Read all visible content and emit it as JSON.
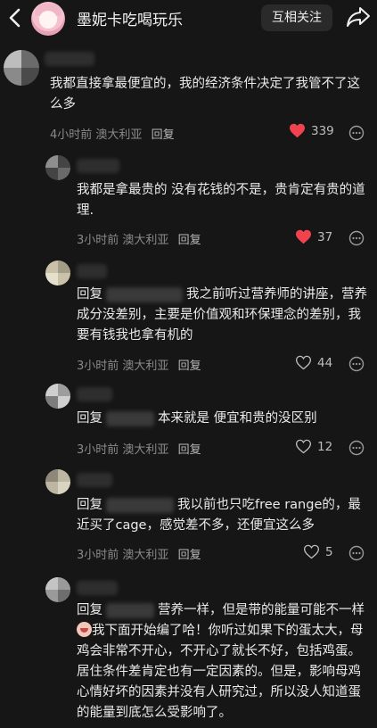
{
  "header": {
    "title": "墨妮卡吃喝玩乐",
    "follow_label": "互相关注"
  },
  "comments": [
    {
      "text": "我都直接拿最便宜的，我的经济条件决定了我管不了这么多",
      "time": "4小时前",
      "location": "澳大利亚",
      "reply_label": "回复",
      "likes": "339",
      "liked": true
    },
    {
      "text": "我都是拿最贵的 没有花钱的不是，贵肯定有贵的道理.",
      "time": "3小时前",
      "location": "澳大利亚",
      "reply_label": "回复",
      "likes": "37",
      "liked": true
    },
    {
      "reply_prefix": "回复",
      "text": "我之前听过营养师的讲座，营养成分没差别，主要是价值观和环保理念的差别，我要有钱我也拿有机的",
      "time": "3小时前",
      "location": "澳大利亚",
      "reply_label": "回复",
      "likes": "44",
      "liked": false
    },
    {
      "reply_prefix": "回复",
      "text": "本来就是 便宜和贵的没区别",
      "time": "3小时前",
      "location": "澳大利亚",
      "reply_label": "回复",
      "likes": "12",
      "liked": false
    },
    {
      "reply_prefix": "回复",
      "text": "我以前也只吃free range的，最近买了cage，感觉差不多，还便宜这么多",
      "time": "3小时前",
      "location": "澳大利亚",
      "reply_label": "回复",
      "likes": "5",
      "liked": false
    },
    {
      "reply_prefix": "回复",
      "text_a": "营养一样，但是带的能量可能不一样",
      "text_b": "我下面开始编了哈！你听过如果下的蛋太大，母鸡会非常不开心，不开心了就长不好，包括鸡蛋。居住条件差肯定也有一定因素的。但是，影响母鸡心情好坏的因素并没有人研究过，所以没人知道蛋的能量到底怎么受影响了。"
    }
  ],
  "colors": {
    "like_active": "#f0434f",
    "background": "#161616"
  }
}
